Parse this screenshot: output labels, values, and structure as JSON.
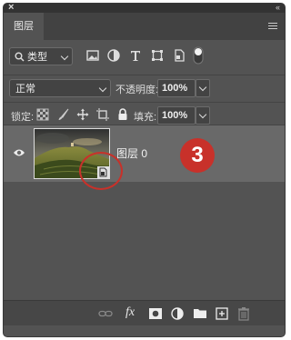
{
  "window": {
    "close_glyph": "×",
    "collapse_glyph": "‹‹"
  },
  "tabs": [
    {
      "label": "图层",
      "active": true
    }
  ],
  "filter": {
    "kind_label": "类型",
    "icons": [
      "image-filter-icon",
      "adjustment-filter-icon",
      "type-filter-icon",
      "shape-filter-icon",
      "smart-object-filter-icon",
      "filter-toggle-icon"
    ]
  },
  "blend": {
    "mode": "正常",
    "opacity_label": "不透明度:",
    "opacity_value": "100%"
  },
  "lock": {
    "label": "锁定:",
    "icons": [
      "lock-transparent-pixels-icon",
      "lock-image-pixels-icon",
      "lock-position-icon",
      "lock-artboard-icon",
      "lock-all-icon"
    ],
    "fill_label": "填充:",
    "fill_value": "100%"
  },
  "layers": [
    {
      "name": "图层 0",
      "visible": true,
      "smart_object": true
    }
  ],
  "annotation": {
    "number": "3",
    "color": "#c8312a"
  },
  "footer": {
    "icons": [
      "link-layers-icon",
      "fx-icon",
      "add-mask-icon",
      "adjustment-layer-icon",
      "new-group-icon",
      "new-layer-icon",
      "delete-layer-icon"
    ],
    "fx_label": "fx"
  },
  "colors": {
    "panel": "#535353",
    "selected_layer": "#696969",
    "annotation_red": "#c8312a"
  }
}
